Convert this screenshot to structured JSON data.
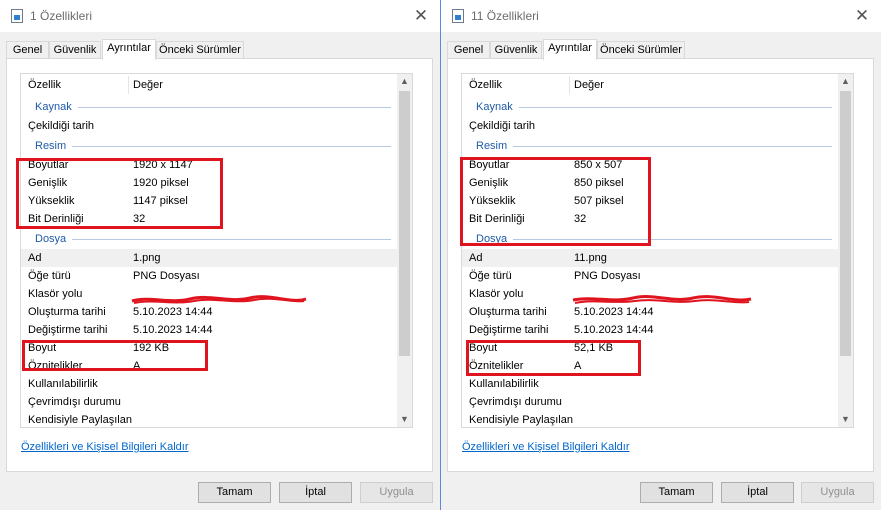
{
  "windows": [
    {
      "title": "1 Özellikleri",
      "tabs": [
        "Genel",
        "Güvenlik",
        "Ayrıntılar",
        "Önceki Sürümler"
      ],
      "active_tab": "Ayrıntılar",
      "columns": {
        "name": "Özellik",
        "value": "Değer"
      },
      "rows": [
        {
          "type": "group",
          "name": "Kaynak"
        },
        {
          "name": "Çekildiği tarih",
          "value": ""
        },
        {
          "type": "group",
          "name": "Resim"
        },
        {
          "name": "Boyutlar",
          "value": "1920 x 1147"
        },
        {
          "name": "Genişlik",
          "value": "1920 piksel"
        },
        {
          "name": "Yükseklik",
          "value": "1147 piksel"
        },
        {
          "name": "Bit Derinliği",
          "value": "32"
        },
        {
          "type": "group",
          "name": "Dosya"
        },
        {
          "name": "Ad",
          "value": "1.png",
          "selected": true
        },
        {
          "name": "Öğe türü",
          "value": "PNG Dosyası"
        },
        {
          "name": "Klasör yolu",
          "value": "",
          "redacted": true
        },
        {
          "name": "Oluşturma tarihi",
          "value": "5.10.2023 14:44"
        },
        {
          "name": "Değiştirme tarihi",
          "value": "5.10.2023 14:44"
        },
        {
          "name": "Boyut",
          "value": "192 KB"
        },
        {
          "name": "Öznitelikler",
          "value": "A"
        },
        {
          "name": "Kullanılabilirlik",
          "value": ""
        },
        {
          "name": "Çevrimdışı durumu",
          "value": ""
        },
        {
          "name": "Kendisiyle Paylaşılan",
          "value": ""
        }
      ],
      "remove_link": "Özellikleri ve Kişisel Bilgileri Kaldır",
      "buttons": {
        "ok": "Tamam",
        "cancel": "İptal",
        "apply": "Uygula"
      }
    },
    {
      "title": "11 Özellikleri",
      "tabs": [
        "Genel",
        "Güvenlik",
        "Ayrıntılar",
        "Önceki Sürümler"
      ],
      "active_tab": "Ayrıntılar",
      "columns": {
        "name": "Özellik",
        "value": "Değer"
      },
      "rows": [
        {
          "type": "group",
          "name": "Kaynak"
        },
        {
          "name": "Çekildiği tarih",
          "value": ""
        },
        {
          "type": "group",
          "name": "Resim"
        },
        {
          "name": "Boyutlar",
          "value": "850 x 507"
        },
        {
          "name": "Genişlik",
          "value": "850 piksel"
        },
        {
          "name": "Yükseklik",
          "value": "507 piksel"
        },
        {
          "name": "Bit Derinliği",
          "value": "32"
        },
        {
          "type": "group",
          "name": "Dosya"
        },
        {
          "name": "Ad",
          "value": "11.png",
          "selected": true
        },
        {
          "name": "Öğe türü",
          "value": "PNG Dosyası"
        },
        {
          "name": "Klasör yolu",
          "value": "",
          "redacted": true
        },
        {
          "name": "Oluşturma tarihi",
          "value": "5.10.2023 14:44"
        },
        {
          "name": "Değiştirme tarihi",
          "value": "5.10.2023 14:44"
        },
        {
          "name": "Boyut",
          "value": "52,1 KB"
        },
        {
          "name": "Öznitelikler",
          "value": "A"
        },
        {
          "name": "Kullanılabilirlik",
          "value": ""
        },
        {
          "name": "Çevrimdışı durumu",
          "value": ""
        },
        {
          "name": "Kendisiyle Paylaşılan",
          "value": ""
        }
      ],
      "remove_link": "Özellikleri ve Kişisel Bilgileri Kaldır",
      "buttons": {
        "ok": "Tamam",
        "cancel": "İptal",
        "apply": "Uygula"
      }
    }
  ],
  "colors": {
    "annotation": "#e0141e",
    "link": "#0066cc",
    "group_label": "#1e5aa8"
  },
  "icons": {
    "file": "image-file-icon",
    "close": "close-icon",
    "scroll_up": "scroll-up-icon",
    "scroll_down": "scroll-down-icon"
  }
}
